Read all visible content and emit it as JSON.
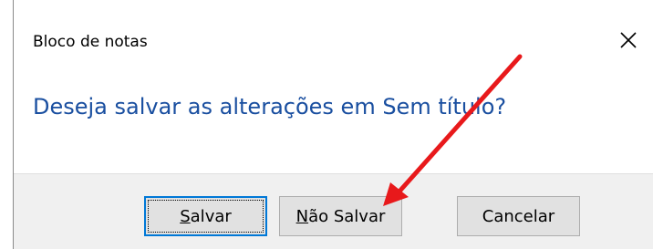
{
  "dialog": {
    "title": "Bloco de notas",
    "message": "Deseja salvar as alterações em Sem título?",
    "close_icon": "close-icon",
    "buttons": {
      "save": {
        "accel": "S",
        "rest": "alvar"
      },
      "dont_save": {
        "accel": "N",
        "rest": "ão Salvar"
      },
      "cancel": {
        "label": "Cancelar"
      }
    }
  },
  "annotation": {
    "arrow_color": "#e8191b",
    "points_to": "Não Salvar"
  },
  "colors": {
    "message_text": "#1a4fa0",
    "default_button_border": "#0078d7",
    "button_face": "#e1e1e1",
    "footer_background": "#f0f0f0"
  }
}
